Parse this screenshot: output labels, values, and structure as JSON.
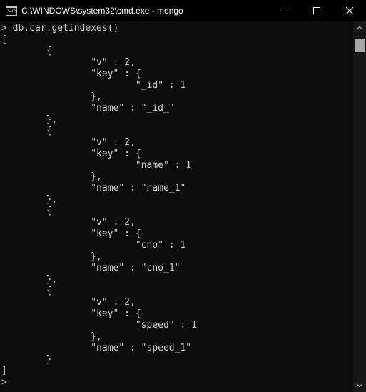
{
  "window": {
    "title": "C:\\WINDOWS\\system32\\cmd.exe - mongo",
    "icon_glyph": "C:\\",
    "icon": "console-window-icon"
  },
  "controls": {
    "minimize_icon": "minimize-icon",
    "maximize_icon": "maximize-icon",
    "close_icon": "close-icon"
  },
  "console": {
    "lines": [
      "> db.car.getIndexes()",
      "[",
      "        {",
      "                \"v\" : 2,",
      "                \"key\" : {",
      "                        \"_id\" : 1",
      "                },",
      "                \"name\" : \"_id_\"",
      "        },",
      "        {",
      "                \"v\" : 2,",
      "                \"key\" : {",
      "                        \"name\" : 1",
      "                },",
      "                \"name\" : \"name_1\"",
      "        },",
      "        {",
      "                \"v\" : 2,",
      "                \"key\" : {",
      "                        \"cno\" : 1",
      "                },",
      "                \"name\" : \"cno_1\"",
      "        },",
      "        {",
      "                \"v\" : 2,",
      "                \"key\" : {",
      "                        \"speed\" : 1",
      "                },",
      "                \"name\" : \"speed_1\"",
      "        }",
      "]",
      ">"
    ]
  },
  "colors": {
    "console_bg": "#0c0c0c",
    "console_text": "#cccccc",
    "titlebar_bg": "#000000",
    "titlebar_text": "#ffffff",
    "scrollbar_thumb": "#a6a6a6"
  }
}
